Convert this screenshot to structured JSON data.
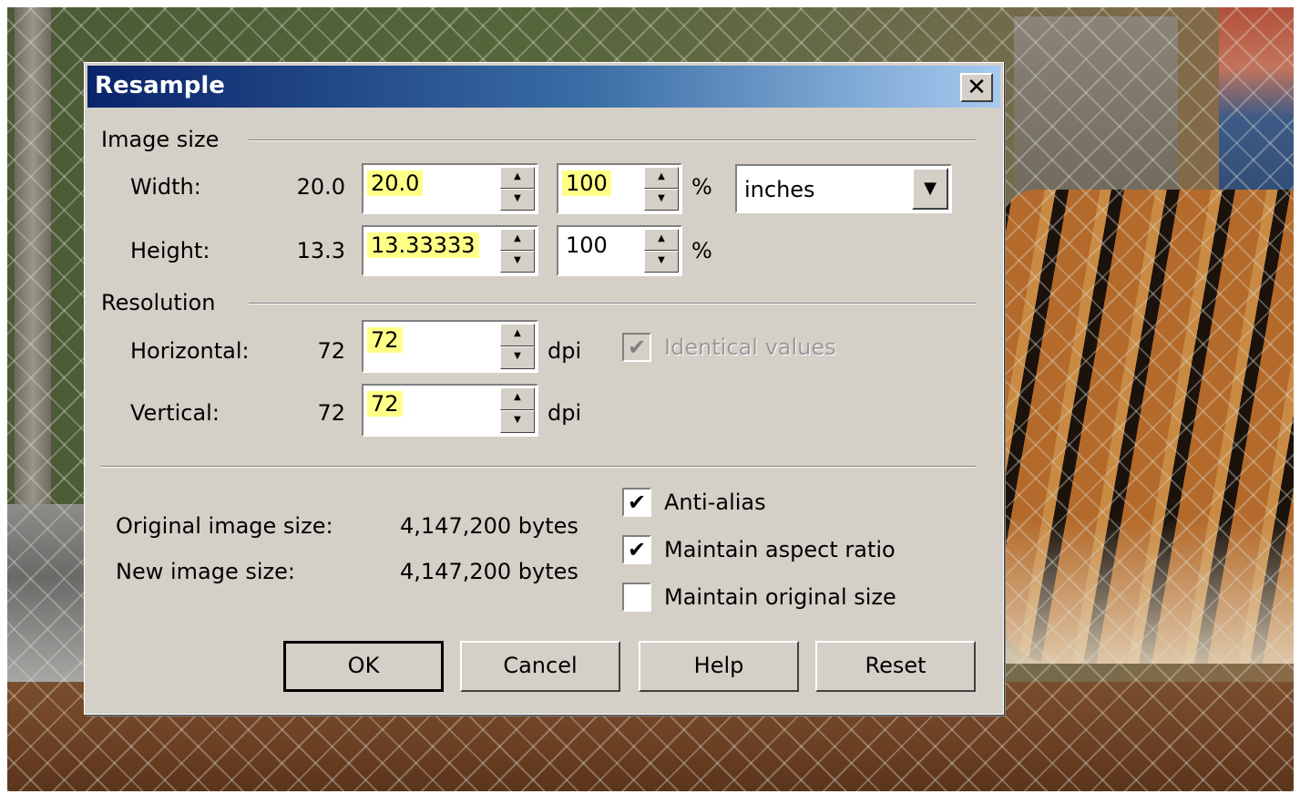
{
  "dialog": {
    "title": "Resample",
    "close_glyph": "✕"
  },
  "image_size": {
    "section_label": "Image size",
    "width": {
      "label": "Width:",
      "current": "20.0",
      "value": "20.0",
      "percent": "100",
      "percent_symbol": "%"
    },
    "height": {
      "label": "Height:",
      "current": "13.3",
      "value": "13.33333",
      "percent": "100",
      "percent_symbol": "%"
    },
    "units_select": "inches"
  },
  "resolution": {
    "section_label": "Resolution",
    "horizontal": {
      "label": "Horizontal:",
      "current": "72",
      "value": "72",
      "unit": "dpi"
    },
    "vertical": {
      "label": "Vertical:",
      "current": "72",
      "value": "72",
      "unit": "dpi"
    },
    "identical_values": {
      "label": "Identical values",
      "checked": true,
      "disabled": true
    }
  },
  "sizes": {
    "original_label": "Original image size:",
    "original_value": "4,147,200 bytes",
    "new_label": "New image size:",
    "new_value": "4,147,200 bytes"
  },
  "options": {
    "anti_alias": {
      "label": "Anti-alias",
      "checked": true
    },
    "maintain_aspect": {
      "label": "Maintain aspect ratio",
      "checked": true
    },
    "maintain_original": {
      "label": "Maintain original size",
      "checked": false
    }
  },
  "buttons": {
    "ok": "OK",
    "cancel": "Cancel",
    "help": "Help",
    "reset": "Reset"
  },
  "icons": {
    "check": "✔",
    "spin_up": "▲",
    "spin_down": "▼",
    "dropdown": "▼"
  },
  "colors": {
    "titlebar_start": "#0a246a",
    "titlebar_end": "#a6caf0",
    "dialog_face": "#d4d0c8",
    "highlight": "#ffff88"
  }
}
